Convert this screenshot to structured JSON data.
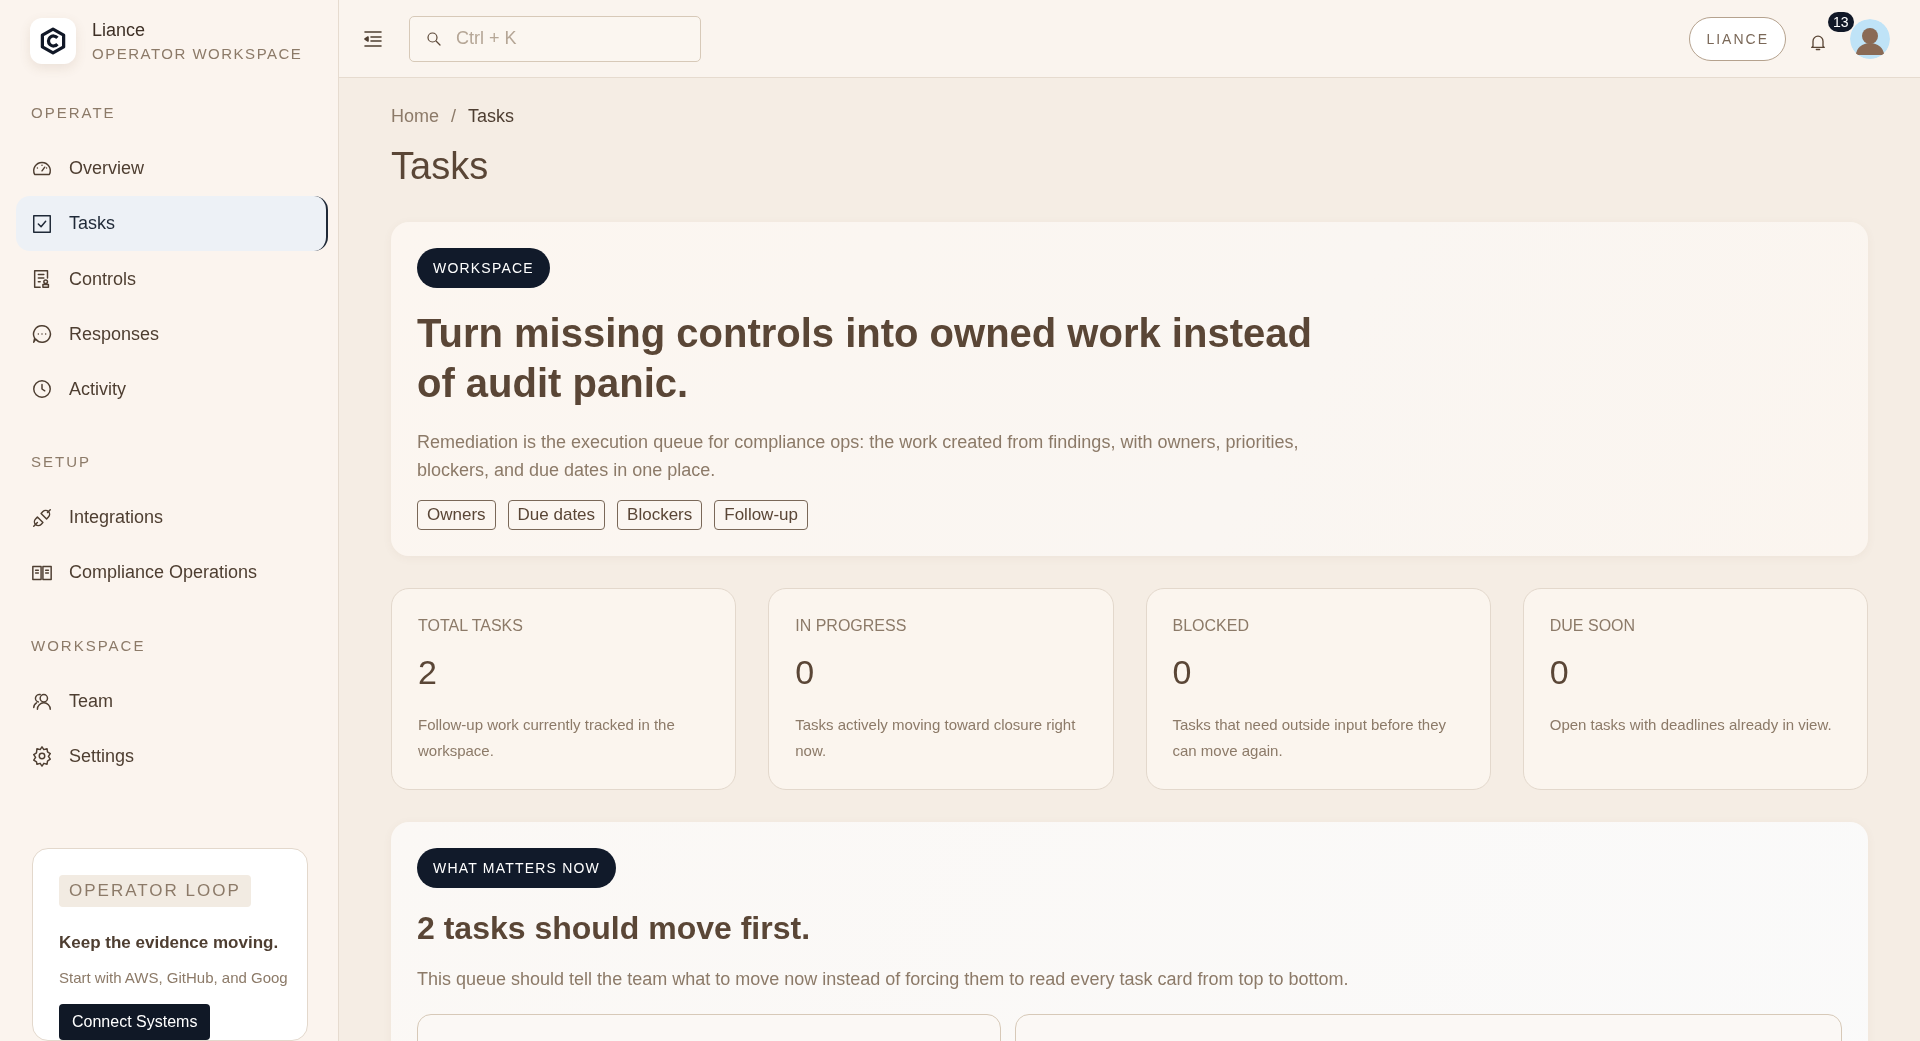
{
  "brand": {
    "name": "Liance",
    "subtitle": "OPERATOR WORKSPACE"
  },
  "sidebar": {
    "sections": [
      {
        "title": "OPERATE",
        "items": [
          {
            "label": "Overview",
            "kind": "gauge",
            "selected": false
          },
          {
            "label": "Tasks",
            "kind": "check",
            "selected": true
          },
          {
            "label": "Controls",
            "kind": "doc",
            "selected": false
          },
          {
            "label": "Responses",
            "kind": "chat",
            "selected": false
          },
          {
            "label": "Activity",
            "kind": "clock",
            "selected": false
          }
        ]
      },
      {
        "title": "SETUP",
        "items": [
          {
            "label": "Integrations",
            "kind": "plug",
            "selected": false
          },
          {
            "label": "Compliance Operations",
            "kind": "book",
            "selected": false
          }
        ]
      },
      {
        "title": "WORKSPACE",
        "items": [
          {
            "label": "Team",
            "kind": "users",
            "selected": false
          },
          {
            "label": "Settings",
            "kind": "gear",
            "selected": false
          }
        ]
      }
    ],
    "promo": {
      "tag": "OPERATOR LOOP",
      "title": "Keep the evidence moving.",
      "text": "Start with AWS, GitHub, and Goog",
      "button": "Connect Systems"
    }
  },
  "topbar": {
    "search": {
      "placeholder": "Ctrl + K"
    },
    "workspace_button": "LIANCE",
    "notifications": "13"
  },
  "breadcrumb": [
    "Home",
    "Tasks"
  ],
  "breadcrumb_separator": "/",
  "page_title": "Tasks",
  "hero": {
    "badge": "WORKSPACE",
    "title": "Turn missing controls into owned work instead of audit panic.",
    "text": "Remediation is the execution queue for compliance ops: the work created from findings, with owners, priorities, blockers, and due dates in one place.",
    "tags": [
      "Owners",
      "Due dates",
      "Blockers",
      "Follow-up"
    ]
  },
  "stats": [
    {
      "label": "TOTAL TASKS",
      "value": "2",
      "text": "Follow-up work currently tracked in the workspace."
    },
    {
      "label": "IN PROGRESS",
      "value": "0",
      "text": "Tasks actively moving toward closure right now."
    },
    {
      "label": "BLOCKED",
      "value": "0",
      "text": "Tasks that need outside input before they can move again."
    },
    {
      "label": "DUE SOON",
      "value": "0",
      "text": "Open tasks with deadlines already in view."
    }
  ],
  "focus": {
    "badge": "WHAT MATTERS NOW",
    "title": "2 tasks should move first.",
    "text": "This queue should tell the team what to move now instead of forcing them to read every task card from top to bottom.",
    "cards": [
      {
        "kind": "narrow"
      },
      {
        "kind": "wide"
      }
    ]
  }
}
